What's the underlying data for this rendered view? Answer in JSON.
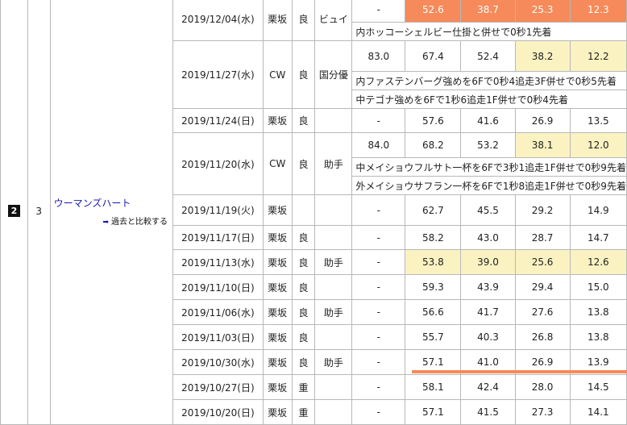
{
  "entry": {
    "wakuban": "2",
    "umaban": "3",
    "horse_name": "ウーマンズハート",
    "compare_label": "過去と比較する",
    "compare_icon": "arrow-right-icon"
  },
  "colors": {
    "highlight_yellow": "#fbf2c2",
    "highlight_orange": "#f68a5a"
  },
  "workouts": [
    {
      "date": "2019/12/04(水)",
      "course": "栗坂",
      "cond": "良",
      "rider": "ビュイ",
      "t5": "-",
      "t4": "52.6",
      "t3": "38.7",
      "t2": "25.3",
      "t1": "12.3",
      "comments": [
        "内ホッコーシェルビー仕掛と併せで0秒1先着"
      ]
    },
    {
      "date": "2019/11/27(水)",
      "course": "CW",
      "cond": "良",
      "rider": "国分優",
      "t5": "83.0",
      "t4": "67.4",
      "t3": "52.4",
      "t2": "38.2",
      "t1": "12.2",
      "comments": [
        "内ファステンバーグ強めを6Fで0秒4追走3F併せで0秒5先着",
        "中テゴナ強めを6Fで1秒6追走1F併せで0秒4先着"
      ]
    },
    {
      "date": "2019/11/24(日)",
      "course": "栗坂",
      "cond": "良",
      "rider": "",
      "t5": "-",
      "t4": "57.6",
      "t3": "41.6",
      "t2": "26.9",
      "t1": "13.5",
      "comments": []
    },
    {
      "date": "2019/11/20(水)",
      "course": "CW",
      "cond": "良",
      "rider": "助手",
      "t5": "84.0",
      "t4": "68.2",
      "t3": "53.2",
      "t2": "38.1",
      "t1": "12.0",
      "comments": [
        "中メイショウフルサト一杯を6Fで3秒1追走1F併せで0秒9先着",
        "外メイショウサフラン一杯を6Fで1秒8追走1F併せで0秒9先着"
      ]
    },
    {
      "date": "2019/11/19(火)",
      "course": "栗坂",
      "cond": "",
      "rider": "",
      "t5": "-",
      "t4": "62.7",
      "t3": "45.5",
      "t2": "29.2",
      "t1": "14.9",
      "comments": []
    },
    {
      "date": "2019/11/17(日)",
      "course": "栗坂",
      "cond": "良",
      "rider": "",
      "t5": "-",
      "t4": "58.2",
      "t3": "43.0",
      "t2": "28.7",
      "t1": "14.7",
      "comments": []
    },
    {
      "date": "2019/11/13(水)",
      "course": "栗坂",
      "cond": "良",
      "rider": "助手",
      "t5": "-",
      "t4": "53.8",
      "t3": "39.0",
      "t2": "25.6",
      "t1": "12.6",
      "comments": []
    },
    {
      "date": "2019/11/10(日)",
      "course": "栗坂",
      "cond": "良",
      "rider": "",
      "t5": "-",
      "t4": "59.3",
      "t3": "43.9",
      "t2": "29.4",
      "t1": "15.0",
      "comments": []
    },
    {
      "date": "2019/11/06(水)",
      "course": "栗坂",
      "cond": "良",
      "rider": "助手",
      "t5": "-",
      "t4": "56.6",
      "t3": "41.7",
      "t2": "27.6",
      "t1": "13.8",
      "comments": []
    },
    {
      "date": "2019/11/03(日)",
      "course": "栗坂",
      "cond": "良",
      "rider": "",
      "t5": "-",
      "t4": "55.7",
      "t3": "40.3",
      "t2": "26.8",
      "t1": "13.8",
      "comments": []
    },
    {
      "date": "2019/10/30(水)",
      "course": "栗坂",
      "cond": "良",
      "rider": "助手",
      "t5": "-",
      "t4": "57.1",
      "t3": "41.0",
      "t2": "26.9",
      "t1": "13.9",
      "comments": []
    },
    {
      "date": "2019/10/27(日)",
      "course": "栗坂",
      "cond": "重",
      "rider": "",
      "t5": "-",
      "t4": "58.1",
      "t3": "42.4",
      "t2": "28.0",
      "t1": "14.5",
      "comments": []
    },
    {
      "date": "2019/10/20(日)",
      "course": "栗坂",
      "cond": "重",
      "rider": "",
      "t5": "-",
      "t4": "57.1",
      "t3": "41.5",
      "t2": "27.3",
      "t1": "14.1",
      "comments": []
    }
  ]
}
